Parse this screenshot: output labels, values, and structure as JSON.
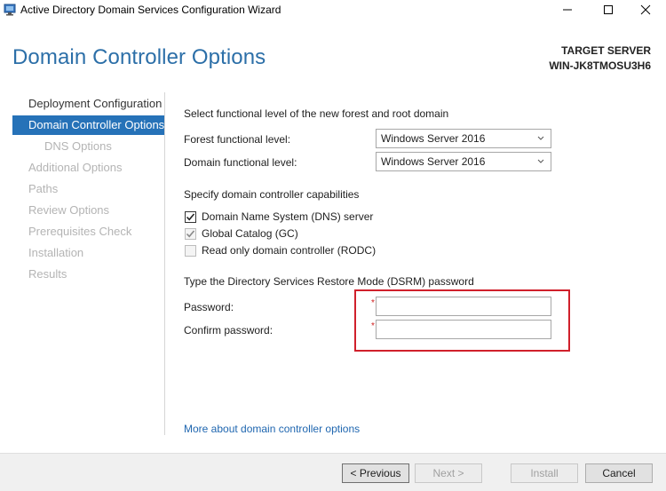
{
  "window": {
    "title": "Active Directory Domain Services Configuration Wizard"
  },
  "header": {
    "page_title": "Domain Controller Options",
    "target_label": "TARGET SERVER",
    "target_name": "WIN-JK8TMOSU3H6"
  },
  "nav": {
    "items": [
      {
        "label": "Deployment Configuration",
        "state": "done"
      },
      {
        "label": "Domain Controller Options",
        "state": "active"
      },
      {
        "label": "DNS Options",
        "state": "pending"
      },
      {
        "label": "Additional Options",
        "state": "pending"
      },
      {
        "label": "Paths",
        "state": "pending"
      },
      {
        "label": "Review Options",
        "state": "pending"
      },
      {
        "label": "Prerequisites Check",
        "state": "pending"
      },
      {
        "label": "Installation",
        "state": "pending"
      },
      {
        "label": "Results",
        "state": "pending"
      }
    ]
  },
  "functional_level": {
    "heading": "Select functional level of the new forest and root domain",
    "forest_label": "Forest functional level:",
    "forest_value": "Windows Server 2016",
    "domain_label": "Domain functional level:",
    "domain_value": "Windows Server 2016"
  },
  "capabilities": {
    "heading": "Specify domain controller capabilities",
    "dns_label": "Domain Name System (DNS) server",
    "dns_checked": true,
    "gc_label": "Global Catalog (GC)",
    "gc_checked": true,
    "rodc_label": "Read only domain controller (RODC)",
    "rodc_checked": false
  },
  "dsrm": {
    "heading": "Type the Directory Services Restore Mode (DSRM) password",
    "password_label": "Password:",
    "password_value": "",
    "confirm_label": "Confirm password:",
    "confirm_value": "",
    "required_marker": "*"
  },
  "more_link": "More about domain controller options",
  "footer": {
    "previous": "< Previous",
    "next": "Next >",
    "install": "Install",
    "cancel": "Cancel"
  },
  "colors": {
    "accent": "#2672b8",
    "title": "#2c6fa8",
    "highlight": "#d0202b",
    "link": "#2067b0"
  }
}
